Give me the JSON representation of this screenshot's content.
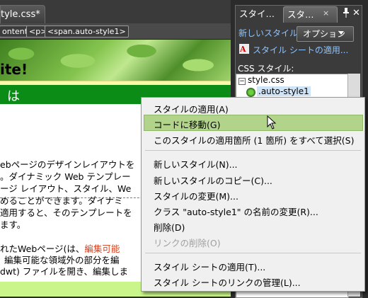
{
  "editor": {
    "doc_tab": "tyle.css*",
    "tag_selector": [
      "ontent>",
      "<p>",
      "<span.auto-style1>"
    ],
    "heading": "ite!",
    "green_text": "は",
    "body_lines": [
      "ebページのデザインレイアウトを",
      "。ダイナミック Web テンプレー",
      "ージ レイアウト、スタイル、We",
      "めることができます。ダイナミ",
      "適用すると、そのテンプレートを",
      "ます。"
    ],
    "body_lines2": {
      "pre": "れたWebページ(は、",
      "red": "編集可能",
      "line2": "編集可能な領域外の部分を編",
      "line3": "dwt) ファイルを開き、編集しま"
    },
    "colors": {
      "green_bar": "#0a8c16",
      "red_text": "#d4401e",
      "highlight": "#b1d48a"
    }
  },
  "panel": {
    "tabs": [
      "スタイ…",
      "スタ…"
    ],
    "tab_close": "×",
    "new_style_link": "新しいスタイル...",
    "options_button": "オプション",
    "apply_sheet_link": "スタイル シートの適用...",
    "css_styles_label": "CSS スタイル:",
    "tree_file": "style.css",
    "tree_style": ".auto-style1"
  },
  "context_menu": {
    "items": [
      {
        "label": "スタイルの適用(A)",
        "enabled": true
      },
      {
        "label": "コードに移動(G)",
        "enabled": true,
        "highlighted": true
      },
      {
        "label": "このスタイルの適用箇所 (1 箇所) をすべて選択(S)",
        "enabled": true
      },
      {
        "label": "新しいスタイル(N)...",
        "enabled": true
      },
      {
        "label": "新しいスタイルのコピー(C)...",
        "enabled": true
      },
      {
        "label": "スタイルの変更(M)...",
        "enabled": true
      },
      {
        "label": "クラス \"auto-style1\" の名前の変更(R)...",
        "enabled": true
      },
      {
        "label": "削除(D)",
        "enabled": true
      },
      {
        "label": "リンクの削除(O)",
        "enabled": false
      },
      {
        "label": "スタイル シートの適用(T)...",
        "enabled": true
      },
      {
        "label": "スタイル シートのリンクの管理(L)...",
        "enabled": true
      }
    ]
  }
}
